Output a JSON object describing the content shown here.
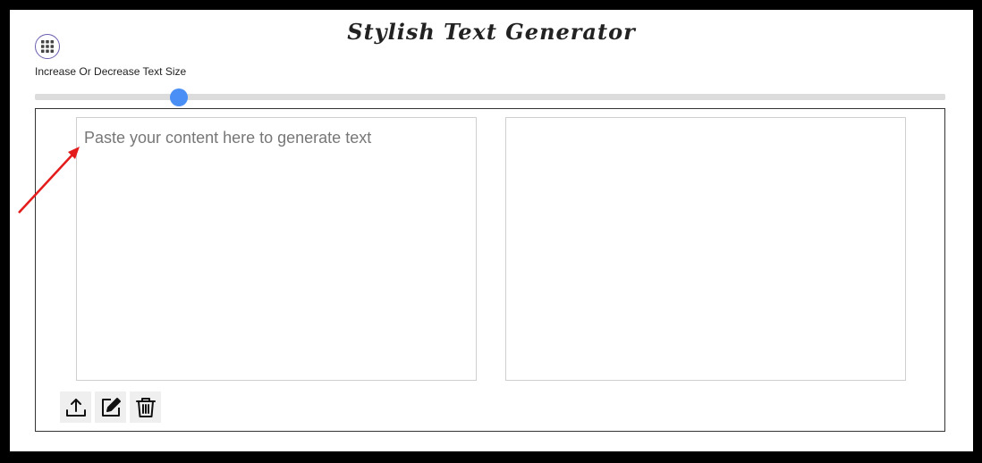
{
  "header": {
    "title": "Stylish Text Generator"
  },
  "controls": {
    "menu_icon": "grid-icon",
    "size_label": "Increase Or Decrease Text Size",
    "slider_value_fraction": 0.158,
    "slider_color": "#4a8ff5"
  },
  "editor": {
    "input_placeholder": "Paste your content here to generate text",
    "input_value": "",
    "output_value": ""
  },
  "toolbar": {
    "icons": [
      "upload-icon",
      "edit-icon",
      "trash-icon"
    ]
  },
  "annotation": {
    "arrow_color": "#e31b1b"
  }
}
